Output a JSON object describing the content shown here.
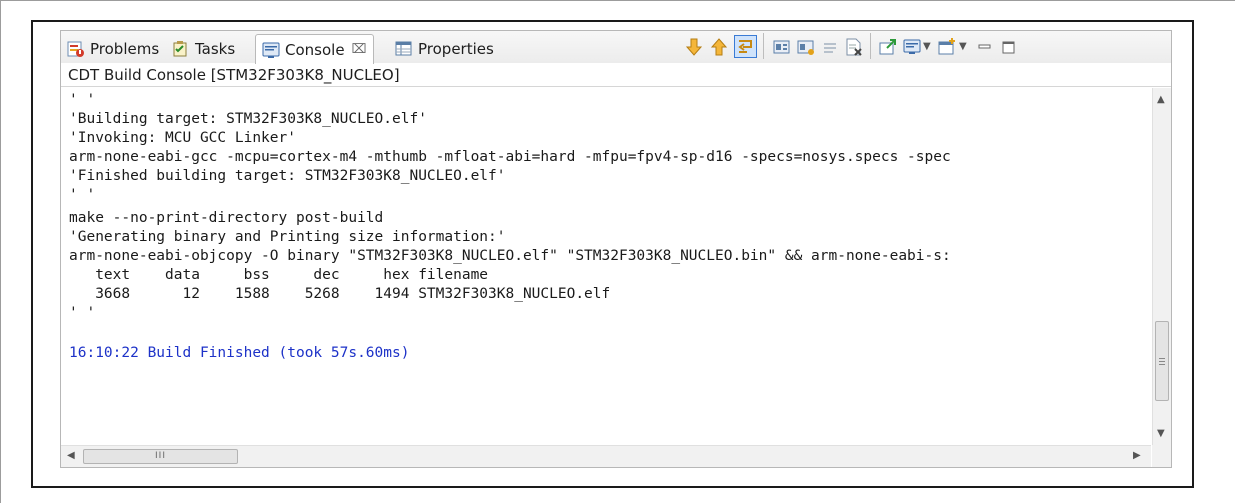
{
  "tabs": [
    {
      "label": "Problems",
      "icon": "problems-icon"
    },
    {
      "label": "Tasks",
      "icon": "tasks-icon"
    },
    {
      "label": "Console",
      "icon": "console-icon",
      "active": true,
      "close": "⌧"
    },
    {
      "label": "Properties",
      "icon": "properties-icon"
    }
  ],
  "toolbar": {
    "icons": [
      "scroll-lock-down-icon",
      "scroll-lock-up-icon",
      "word-wrap-icon",
      "clear-console-icon",
      "pin-console-icon",
      "show-console-icon",
      "copy-icon",
      "open-console-icon",
      "display-console-icon",
      "new-console-icon",
      "minimize-icon",
      "maximize-icon"
    ]
  },
  "console": {
    "title": "CDT Build Console [STM32F303K8_NUCLEO]",
    "lines": [
      "' '",
      "'Building target: STM32F303K8_NUCLEO.elf'",
      "'Invoking: MCU GCC Linker'",
      "arm-none-eabi-gcc -mcpu=cortex-m4 -mthumb -mfloat-abi=hard -mfpu=fpv4-sp-d16 -specs=nosys.specs -spec",
      "'Finished building target: STM32F303K8_NUCLEO.elf'",
      "' '",
      "make --no-print-directory post-build",
      "'Generating binary and Printing size information:'",
      "arm-none-eabi-objcopy -O binary \"STM32F303K8_NUCLEO.elf\" \"STM32F303K8_NUCLEO.bin\" && arm-none-eabi-s:",
      "   text    data     bss     dec     hex filename",
      "   3668      12    1588    5268    1494 STM32F303K8_NUCLEO.elf",
      "' '",
      "",
      "16:10:22 Build Finished (took 57s.60ms)"
    ]
  },
  "scroll": {
    "hthumb_label": "III"
  },
  "colors": {
    "finished_text": "#1d32c8",
    "frame": "#1a1a1a"
  }
}
